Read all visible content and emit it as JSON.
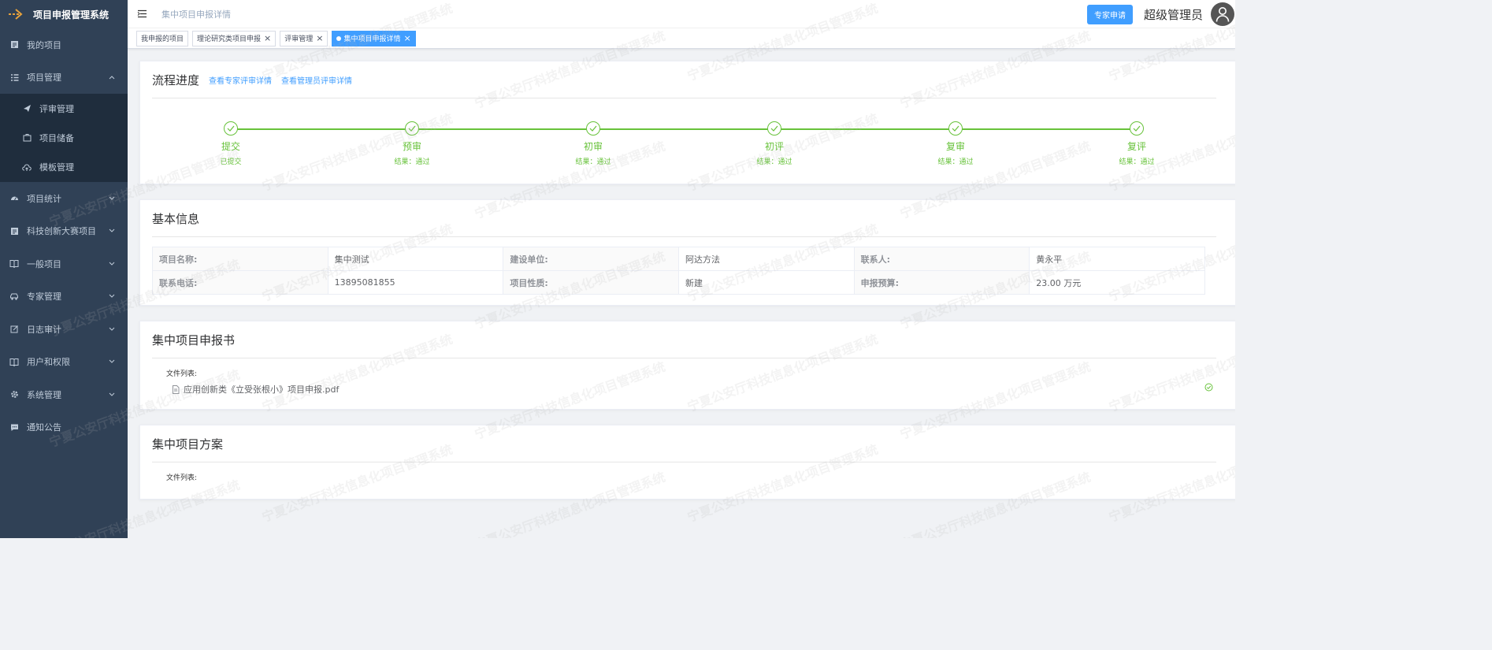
{
  "app": {
    "title": "项目申报管理系统"
  },
  "sidebar": {
    "items": [
      {
        "label": "我的项目",
        "icon": "document-icon"
      },
      {
        "label": "项目管理",
        "icon": "list-icon",
        "expanded": true,
        "children": [
          {
            "label": "评审管理",
            "icon": "send-icon"
          },
          {
            "label": "项目储备",
            "icon": "briefcase-icon"
          },
          {
            "label": "模板管理",
            "icon": "cloud-upload-icon"
          }
        ]
      },
      {
        "label": "项目统计",
        "icon": "dashboard-icon"
      },
      {
        "label": "科技创新大赛项目",
        "icon": "document-icon"
      },
      {
        "label": "一般项目",
        "icon": "book-icon"
      },
      {
        "label": "专家管理",
        "icon": "car-icon"
      },
      {
        "label": "日志审计",
        "icon": "edit-icon"
      },
      {
        "label": "用户和权限",
        "icon": "book-icon"
      },
      {
        "label": "系统管理",
        "icon": "gear-icon"
      },
      {
        "label": "通知公告",
        "icon": "message-icon"
      }
    ]
  },
  "navbar": {
    "breadcrumb": "集中项目申报详情",
    "expert_button": "专家申请",
    "username": "超级管理员"
  },
  "tags": [
    {
      "label": "我申报的项目",
      "closable": false,
      "active": false
    },
    {
      "label": "理论研究类项目申报",
      "closable": true,
      "active": false
    },
    {
      "label": "评审管理",
      "closable": true,
      "active": false
    },
    {
      "label": "集中项目申报详情",
      "closable": true,
      "active": true
    }
  ],
  "progress": {
    "title": "流程进度",
    "link_expert": "查看专家评审详情",
    "link_admin": "查看管理员评审详情",
    "steps": [
      {
        "title": "提交",
        "desc": "已提交"
      },
      {
        "title": "预审",
        "desc": "结果：通过"
      },
      {
        "title": "初审",
        "desc": "结果：通过"
      },
      {
        "title": "初评",
        "desc": "结果：通过"
      },
      {
        "title": "复审",
        "desc": "结果：通过"
      },
      {
        "title": "复评",
        "desc": "结果：通过"
      }
    ],
    "color": "#67c23a"
  },
  "basic": {
    "title": "基本信息",
    "rows": [
      [
        {
          "label": "项目名称:",
          "value": "集中测试"
        },
        {
          "label": "建设单位:",
          "value": "阿达方法"
        },
        {
          "label": "联系人:",
          "value": "黄永平"
        }
      ],
      [
        {
          "label": "联系电话:",
          "value": "13895081855"
        },
        {
          "label": "项目性质:",
          "value": "新建"
        },
        {
          "label": "申报预算:",
          "value": "23.00 万元"
        }
      ]
    ]
  },
  "declaration": {
    "title": "集中项目申报书",
    "file_list_label": "文件列表:",
    "files": [
      "应用创新类《立受张根小》项目申报.pdf"
    ]
  },
  "plan": {
    "title": "集中项目方案",
    "file_list_label": "文件列表:"
  },
  "watermark": "宁夏公安厅科技信息化项目管理系统",
  "colors": {
    "sidebar": "#304156",
    "submenu": "#1f2d3d",
    "accent": "#409eff",
    "success": "#67c23a"
  }
}
